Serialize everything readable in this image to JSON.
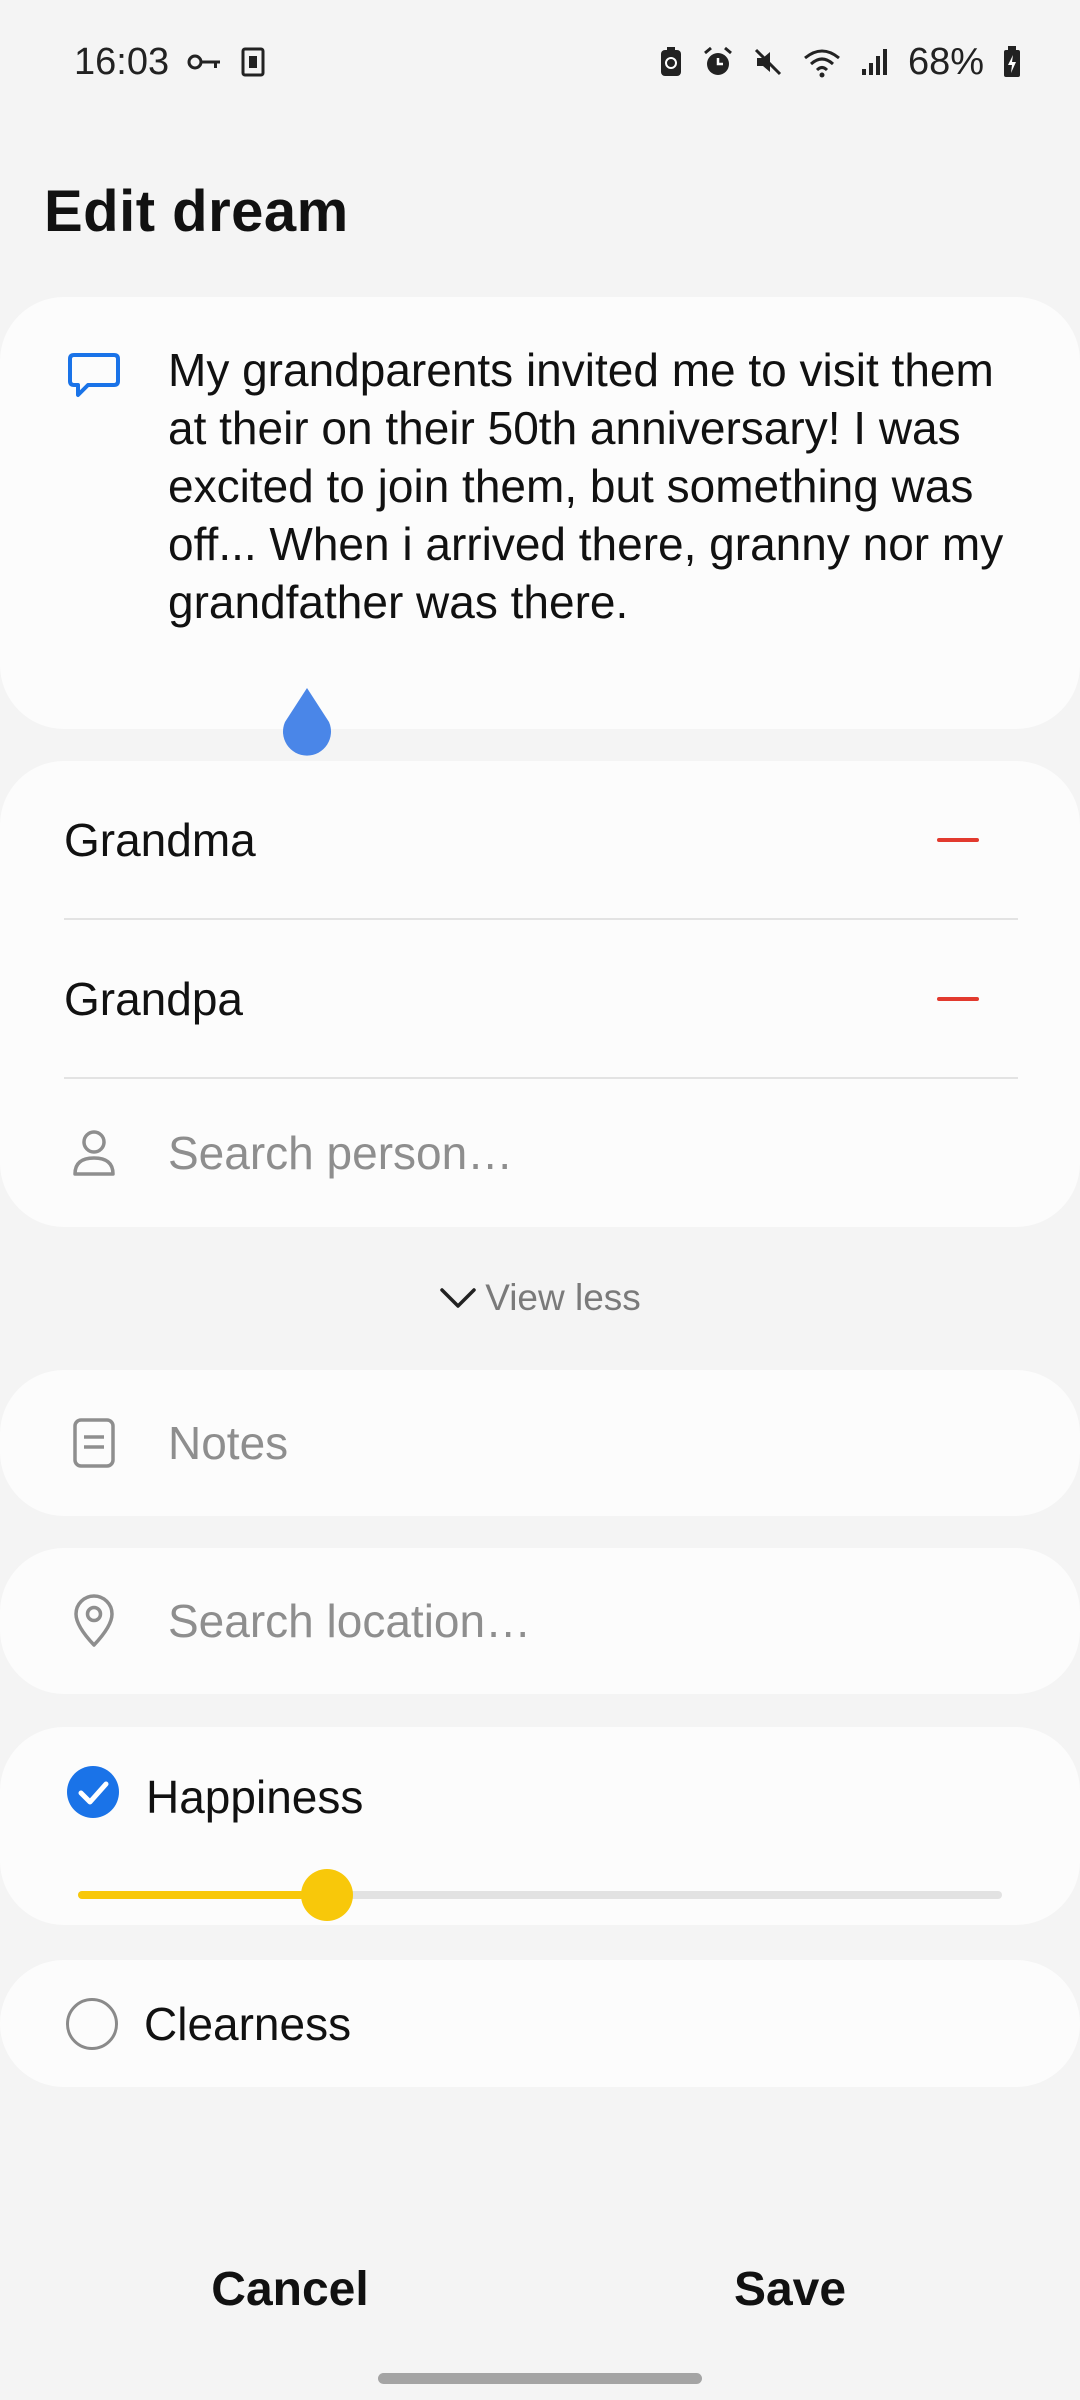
{
  "status_bar": {
    "time": "16:03",
    "battery": "68%",
    "icons": [
      "key-icon",
      "sim-icon",
      "battery-saver-icon",
      "alarm-icon",
      "mute-icon",
      "wifi-icon",
      "signal-icon",
      "battery-icon"
    ]
  },
  "header": {
    "title": "Edit dream"
  },
  "dream": {
    "text": "My grandparents invited me to visit them at their on their 50th anniversary! I was excited to join them, but something was off... When i arrived there, granny nor my grandfather was there.",
    "icon": "comment-icon"
  },
  "people": {
    "items": [
      {
        "name": "Grandma"
      },
      {
        "name": "Grandpa"
      }
    ],
    "search_placeholder": "Search person…"
  },
  "view_less": {
    "label": "View less"
  },
  "notes": {
    "placeholder": "Notes"
  },
  "location": {
    "placeholder": "Search location…"
  },
  "happiness": {
    "label": "Happiness",
    "checked": true,
    "value": 0.27
  },
  "clearness": {
    "label": "Clearness",
    "checked": false
  },
  "actions": {
    "cancel_label": "Cancel",
    "save_label": "Save"
  },
  "colors": {
    "accent_blue": "#1a73e8",
    "slider_yellow": "#f8c80a",
    "remove_red": "#e23a2e"
  }
}
